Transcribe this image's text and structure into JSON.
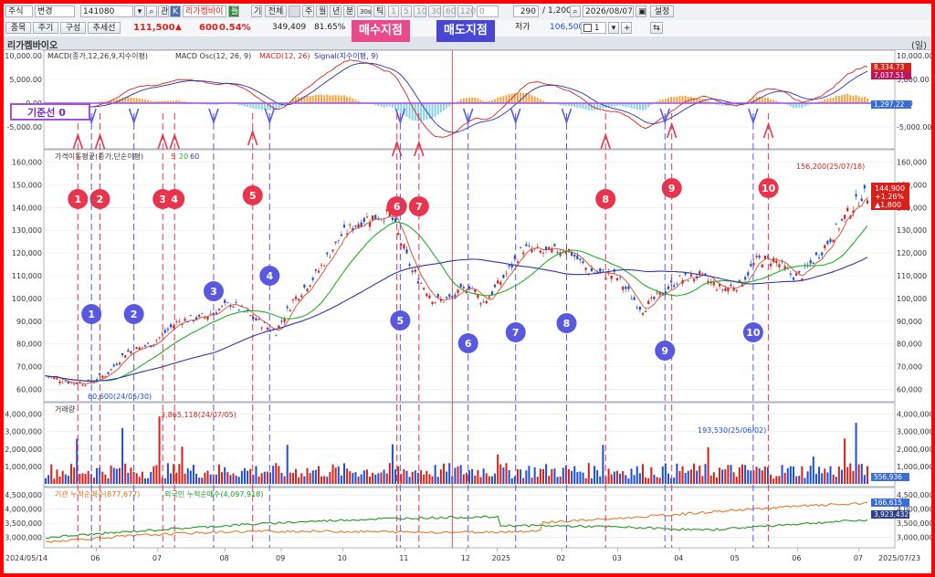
{
  "toolbar": {
    "market": "주식",
    "mode": "변경",
    "code": "141080",
    "watch": "관",
    "stock_name": "리가켐바이",
    "period_btn": "틀",
    "gi": "기",
    "all": "전체",
    "periods": [
      "주",
      "월",
      "년",
      "분",
      "30s",
      "틱"
    ],
    "nums": [
      "1",
      "5",
      "10",
      "30",
      "60",
      "120"
    ],
    "zero": "0",
    "count": "290",
    "total": "1,200",
    "date": "2026/08/07",
    "settings": "설정"
  },
  "toolbar2": {
    "tabs": [
      "종목",
      "주기",
      "구성",
      "추세선"
    ],
    "price": "111,500",
    "change_arrow": "▲",
    "change": "600",
    "change_pct": "0.54%",
    "volume": "349,409",
    "ratio": "81.65%",
    "low_label": "저가",
    "low_value": "106,500",
    "spinner": "1"
  },
  "badges": {
    "buy": "매수지점",
    "sell": "매도지점"
  },
  "title": "리가켐바이오",
  "title_right": "(일)",
  "macd_legend": {
    "main": "MACD(종가,12,26,9,지수이평)",
    "osc": "MACD Osc(12, 26, 9)",
    "macd": "MACD(12, 26)",
    "signal": "Signal(지수이평, 9)"
  },
  "macd_ticks": [
    "10,000.00",
    "5,000.00",
    "0.00",
    "-5,000.00"
  ],
  "macd_right": [
    "8,334.73",
    "7,037.51",
    "1,297.22"
  ],
  "baseline_label": "기준선 0",
  "price_legend": {
    "main": "가격이동평균(종가,단순이평)",
    "p5": "5",
    "p20": "20",
    "p60": "60"
  },
  "price_ticks": [
    "160,000",
    "150,000",
    "140,000",
    "130,000",
    "120,000",
    "110,000",
    "100,000",
    "90,000",
    "80,000",
    "70,000",
    "60,000"
  ],
  "price_right": [
    "144,900",
    "+1.26%",
    "▲1,800"
  ],
  "annotations": {
    "low": "60,600(24/05/30)",
    "high": "156,200(25/07/18)",
    "vol_peak": "3,865,118(24/07/05)",
    "vol_mark": "193,530(25/06/02)"
  },
  "volume_legend": "거래량",
  "volume_ticks": [
    "4,000,000",
    "3,000,000",
    "2,000,000",
    "1,000,000"
  ],
  "volume_right": "556,936",
  "flow_legend": {
    "inst": "기관 누적순매수(877,677)",
    "foreign": "외국인 누적순매수(4,097,918)"
  },
  "flow_ticks": [
    "4,500,000",
    "4,000,000",
    "3,500,000",
    "3,000,000"
  ],
  "flow_right": [
    "166,615",
    "3,923,432"
  ],
  "date_axis": [
    "2024/05/14",
    "06",
    "07",
    "08",
    "09",
    "10",
    "11",
    "12",
    "2025",
    "02",
    "03",
    "04",
    "05",
    "06",
    "07",
    "2025/07/23"
  ],
  "buy_points": [
    "1",
    "2",
    "3",
    "4",
    "5",
    "6",
    "7",
    "8",
    "9",
    "10"
  ],
  "sell_points": [
    "1",
    "2",
    "3",
    "4",
    "5",
    "6",
    "7",
    "8",
    "9",
    "10"
  ],
  "colors": {
    "buy": "#e8354d",
    "sell": "#5959e0",
    "ma5": "#d24a2c",
    "ma20": "#22b022",
    "ma60": "#3535a8",
    "up": "#d6201a",
    "down": "#1d4fd6"
  }
}
